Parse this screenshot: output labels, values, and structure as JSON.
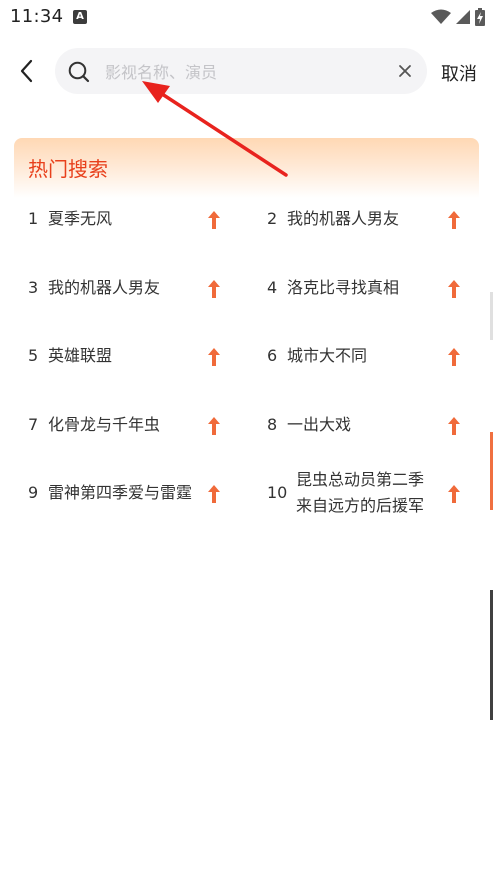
{
  "status_bar": {
    "time": "11:34",
    "app_icon_letter": "A"
  },
  "header": {
    "back_label": "",
    "search_placeholder": "影视名称、演员",
    "search_value": "",
    "cancel_label": "取消"
  },
  "hot_search": {
    "title": "热门搜索",
    "accent_color": "#e8401c",
    "arrow_color": "#f06a3a",
    "items": [
      {
        "rank": "1",
        "name": "夏季无风"
      },
      {
        "rank": "2",
        "name": "我的机器人男友"
      },
      {
        "rank": "3",
        "name": "我的机器人男友"
      },
      {
        "rank": "4",
        "name": "洛克比寻找真相"
      },
      {
        "rank": "5",
        "name": "英雄联盟"
      },
      {
        "rank": "6",
        "name": "城市大不同"
      },
      {
        "rank": "7",
        "name": "化骨龙与千年虫"
      },
      {
        "rank": "8",
        "name": "一出大戏"
      },
      {
        "rank": "9",
        "name": "雷神第四季爱与雷霆"
      },
      {
        "rank": "10",
        "name": "昆虫总动员第二季来自远方的后援军"
      }
    ]
  },
  "icons": {
    "back": "chevron-left-icon",
    "search": "search-icon",
    "clear": "close-icon",
    "trend": "arrow-up-icon",
    "wifi": "wifi-icon",
    "signal": "signal-icon",
    "battery": "battery-icon"
  }
}
